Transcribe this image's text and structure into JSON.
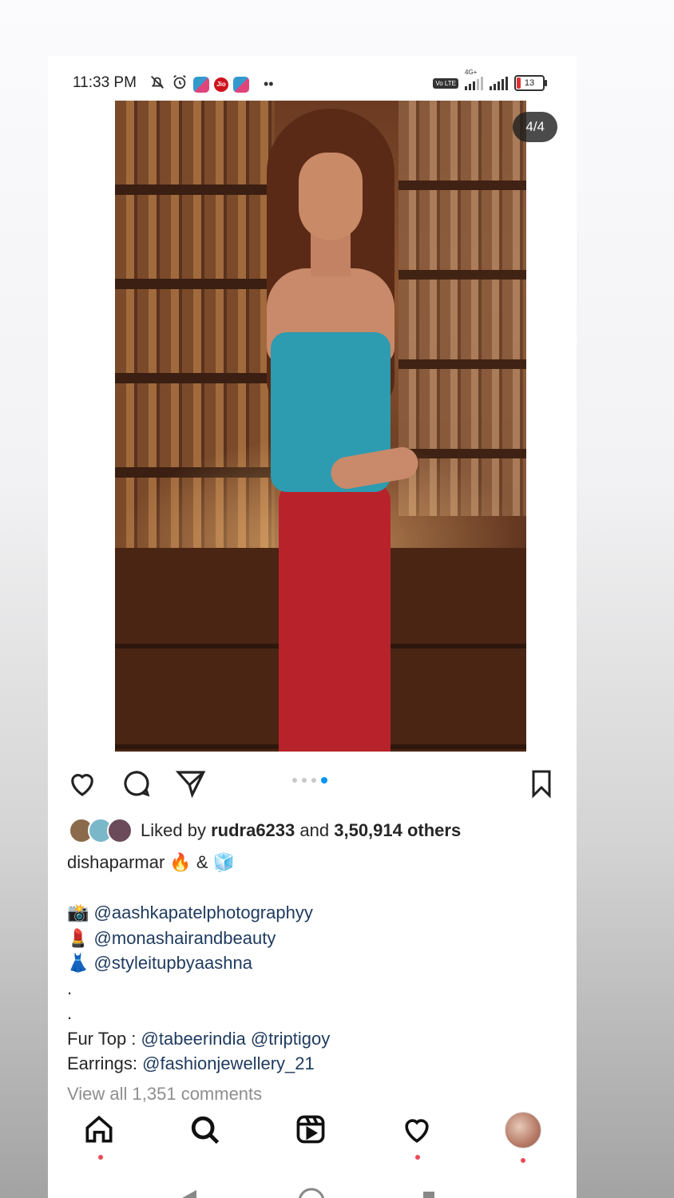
{
  "status_bar": {
    "time": "11:33 PM",
    "carrier_icon": "Jio",
    "volte": "Vo LTE",
    "network": "4G+",
    "battery": "13"
  },
  "post": {
    "image_counter": "4/4",
    "carousel": {
      "total": 4,
      "active": 4
    },
    "liked": {
      "prefix": "Liked by",
      "user": "rudra6233",
      "and": "and",
      "others": "3,50,914 others"
    },
    "caption": {
      "username": "dishaparmar",
      "title_rest": " 🔥 & 🧊",
      "credits": [
        {
          "emoji": "📸",
          "handle": "@aashkapatelphotographyy"
        },
        {
          "emoji": "💄",
          "handle": "@monashairandbeauty"
        },
        {
          "emoji": "👗",
          "handle": "@styleitupbyaashna"
        }
      ],
      "dot1": ".",
      "dot2": ".",
      "fur_top_label": "Fur Top : ",
      "fur_top_mentions": "@tabeerindia @triptigoy",
      "earrings_label": "Earrings: ",
      "earrings_mention": "@fashionjewellery_21"
    },
    "comments_link": "View all 1,351 comments"
  },
  "icons": {
    "like": "heart-icon",
    "comment": "comment-icon",
    "share": "paper-plane-icon",
    "save": "bookmark-icon",
    "home": "home-icon",
    "search": "search-icon",
    "reels": "reels-icon",
    "activity": "heart-icon",
    "profile": "avatar"
  },
  "colors": {
    "accent_blue": "#0095f6",
    "mention": "#1e3a5f",
    "notification_dot": "#ed4956"
  }
}
